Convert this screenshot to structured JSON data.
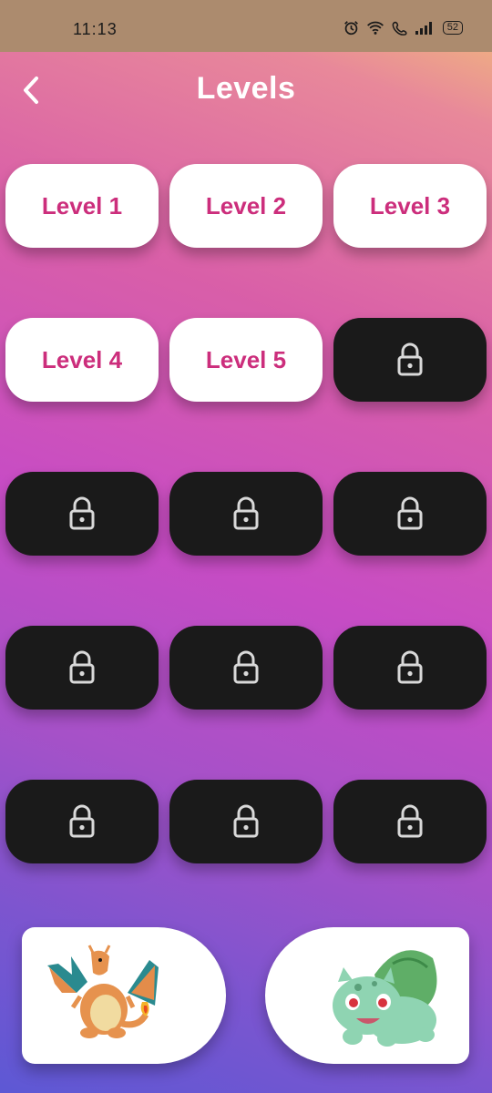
{
  "status_bar": {
    "time": "11:13",
    "battery": "52"
  },
  "header": {
    "title": "Levels",
    "back_icon": "chevron-left-icon"
  },
  "levels": [
    {
      "label": "Level 1",
      "locked": false
    },
    {
      "label": "Level 2",
      "locked": false
    },
    {
      "label": "Level 3",
      "locked": false
    },
    {
      "label": "Level 4",
      "locked": false
    },
    {
      "label": "Level 5",
      "locked": false
    },
    {
      "label": "",
      "locked": true
    },
    {
      "label": "",
      "locked": true
    },
    {
      "label": "",
      "locked": true
    },
    {
      "label": "",
      "locked": true
    },
    {
      "label": "",
      "locked": true
    },
    {
      "label": "",
      "locked": true
    },
    {
      "label": "",
      "locked": true
    },
    {
      "label": "",
      "locked": true
    },
    {
      "label": "",
      "locked": true
    },
    {
      "label": "",
      "locked": true
    }
  ],
  "characters": {
    "left": "charizard-illustration",
    "right": "bulbasaur-illustration"
  },
  "colors": {
    "level_text": "#cc2e7c",
    "locked_bg": "#1a1a1a",
    "open_bg": "#ffffff"
  }
}
